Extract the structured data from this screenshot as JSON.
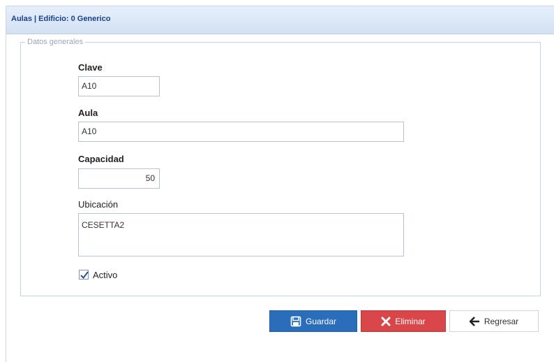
{
  "panel": {
    "title": "Aulas | Edificio: 0 Generico"
  },
  "group": {
    "legend": "Datos generales"
  },
  "fields": {
    "clave": {
      "label": "Clave",
      "value": "A10"
    },
    "aula": {
      "label": "Aula",
      "value": "A10"
    },
    "capacidad": {
      "label": "Capacidad",
      "value": "50"
    },
    "ubicacion": {
      "label": "Ubicación",
      "value": "CESETTA2"
    },
    "activo": {
      "label": "Activo",
      "checked": true
    }
  },
  "buttons": {
    "save": {
      "label": "Guardar",
      "icon": "floppy-disk-icon",
      "color": "#2a6ebb"
    },
    "delete": {
      "label": "Eliminar",
      "icon": "x-icon",
      "color": "#d9464a"
    },
    "back": {
      "label": "Regresar",
      "icon": "arrow-left-icon"
    }
  }
}
